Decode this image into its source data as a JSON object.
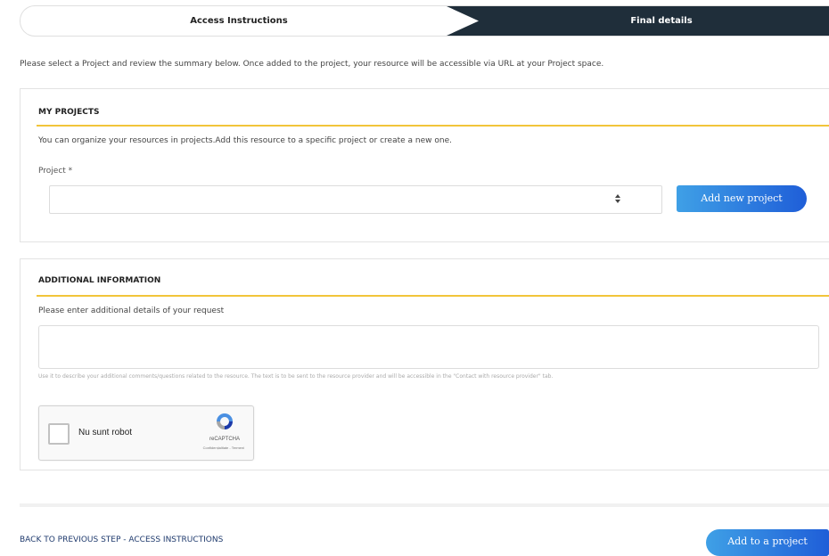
{
  "steps": {
    "step1_label": "Access Instructions",
    "step2_label": "Final details"
  },
  "intro_text": "Please select a Project and review the summary below. Once added to the project, your resource will be accessible via URL at your Project space.",
  "my_projects": {
    "title": "MY PROJECTS",
    "description": "You can organize your resources in projects.Add this resource to a specific project or create a new one.",
    "field_label": "Project *",
    "selected_value": "",
    "arrow_icon": "sort-arrows-icon",
    "add_button_label": "Add new project"
  },
  "additional_info": {
    "title": "ADDITIONAL INFORMATION",
    "description": "Please enter additional details of your request",
    "textarea_value": "",
    "hint": "Use it to describe your additional comments/questions related to the resource. The text is to be sent to the resource provider and will be accessible in the \"Contact with resource provider\" tab."
  },
  "captcha": {
    "label": "Nu sunt robot",
    "brand": "reCAPTCHA",
    "links": "Confidențialitate - Termeni"
  },
  "footer": {
    "back_link": "BACK TO PREVIOUS STEP - ACCESS INSTRUCTIONS",
    "submit_label": "Add to a project"
  },
  "colors": {
    "accent_line": "#f2c53a",
    "active_step_bg": "#1f2e3a",
    "button_gradient_start": "#3fa0e6",
    "button_gradient_end": "#1f5ed8",
    "link": "#1f3a6d"
  }
}
